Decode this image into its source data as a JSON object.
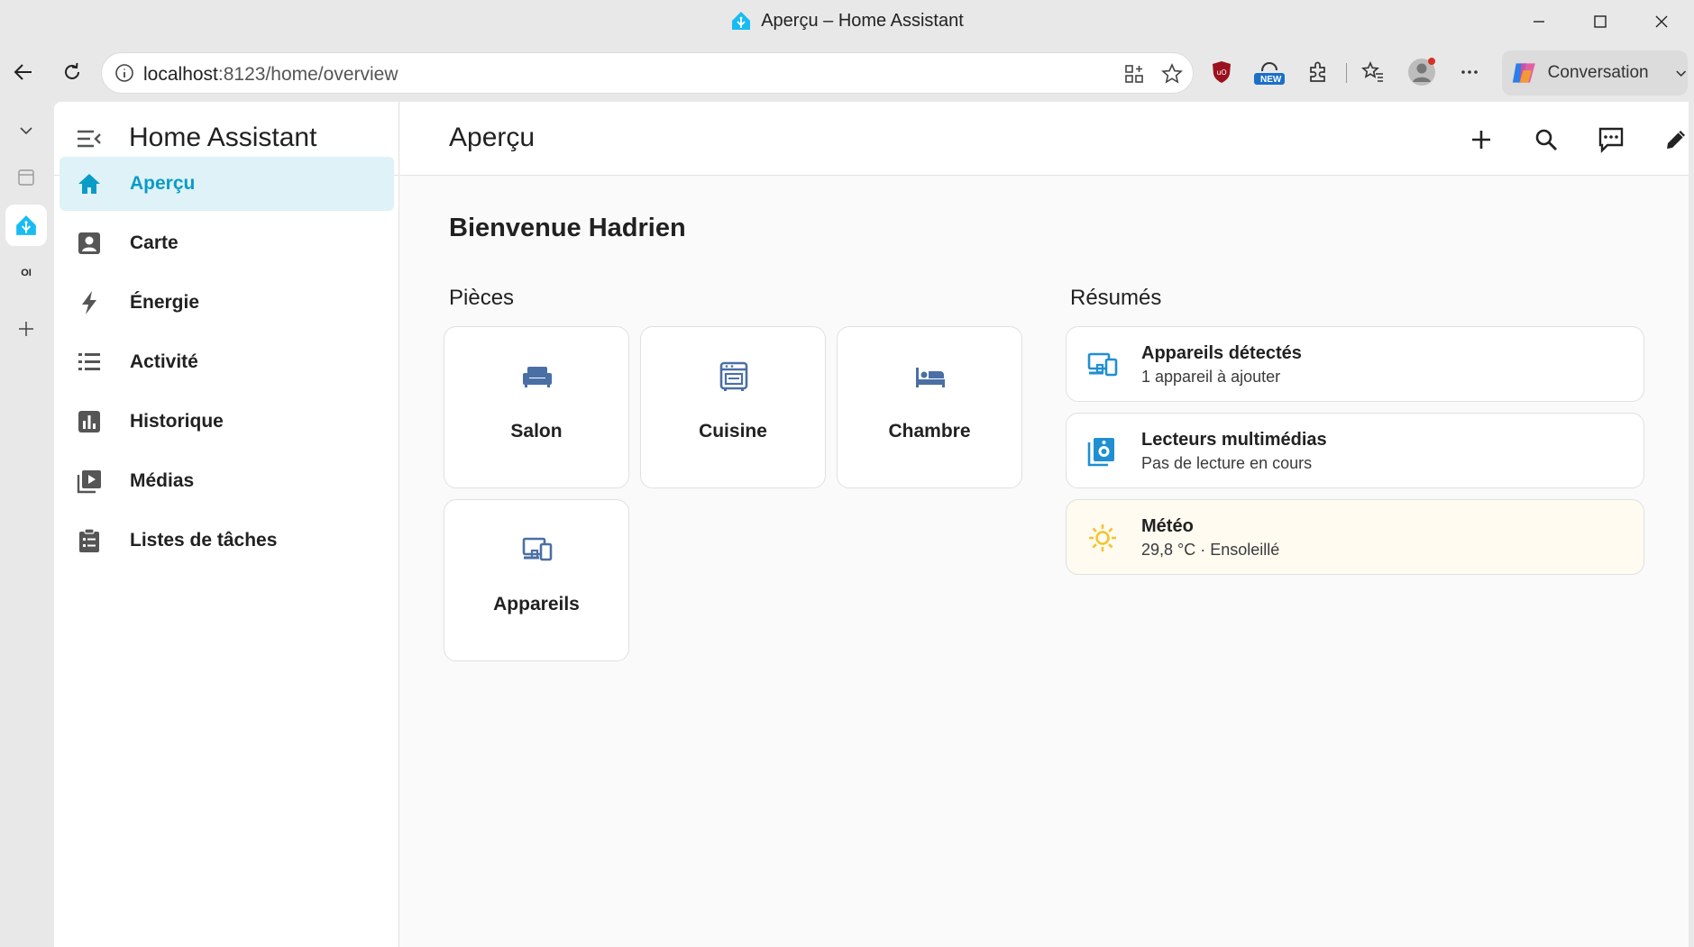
{
  "window": {
    "title": "Aperçu – Home Assistant"
  },
  "browser": {
    "url_host": "localhost",
    "url_path": ":8123/home/overview",
    "conversation_label": "Conversation",
    "new_badge": "NEW",
    "sidebar_oi_label": "OI"
  },
  "ha": {
    "app_title": "Home Assistant",
    "page_title": "Aperçu",
    "welcome": "Bienvenue Hadrien",
    "nav": [
      {
        "label": "Aperçu",
        "icon": "home-icon",
        "active": true
      },
      {
        "label": "Carte",
        "icon": "account-box-icon"
      },
      {
        "label": "Énergie",
        "icon": "lightning-icon"
      },
      {
        "label": "Activité",
        "icon": "format-list-icon"
      },
      {
        "label": "Historique",
        "icon": "chart-box-icon"
      },
      {
        "label": "Médias",
        "icon": "play-box-multiple-icon"
      },
      {
        "label": "Listes de tâches",
        "icon": "clipboard-list-icon"
      }
    ],
    "rooms_title": "Pièces",
    "rooms": [
      {
        "label": "Salon",
        "icon": "sofa-icon"
      },
      {
        "label": "Cuisine",
        "icon": "stove-icon"
      },
      {
        "label": "Chambre",
        "icon": "bed-icon"
      },
      {
        "label": "Appareils",
        "icon": "devices-icon"
      }
    ],
    "summaries_title": "Résumés",
    "summaries": [
      {
        "title": "Appareils détectés",
        "subtitle": "1 appareil à ajouter",
        "icon": "devices-icon"
      },
      {
        "title": "Lecteurs multimédias",
        "subtitle": "Pas de lecture en cours",
        "icon": "speaker-multiple-icon"
      },
      {
        "title": "Météo",
        "subtitle": "29,8 °C · Ensoleillé",
        "icon": "weather-sunny-icon"
      }
    ]
  },
  "colors": {
    "accent": "#0b9bc7",
    "active_bg": "#def2f8",
    "room_icon": "#4a6fa5",
    "summary_icon": "#1f8fd1",
    "sun": "#f4c430",
    "weather_bg": "#fffbf1"
  }
}
